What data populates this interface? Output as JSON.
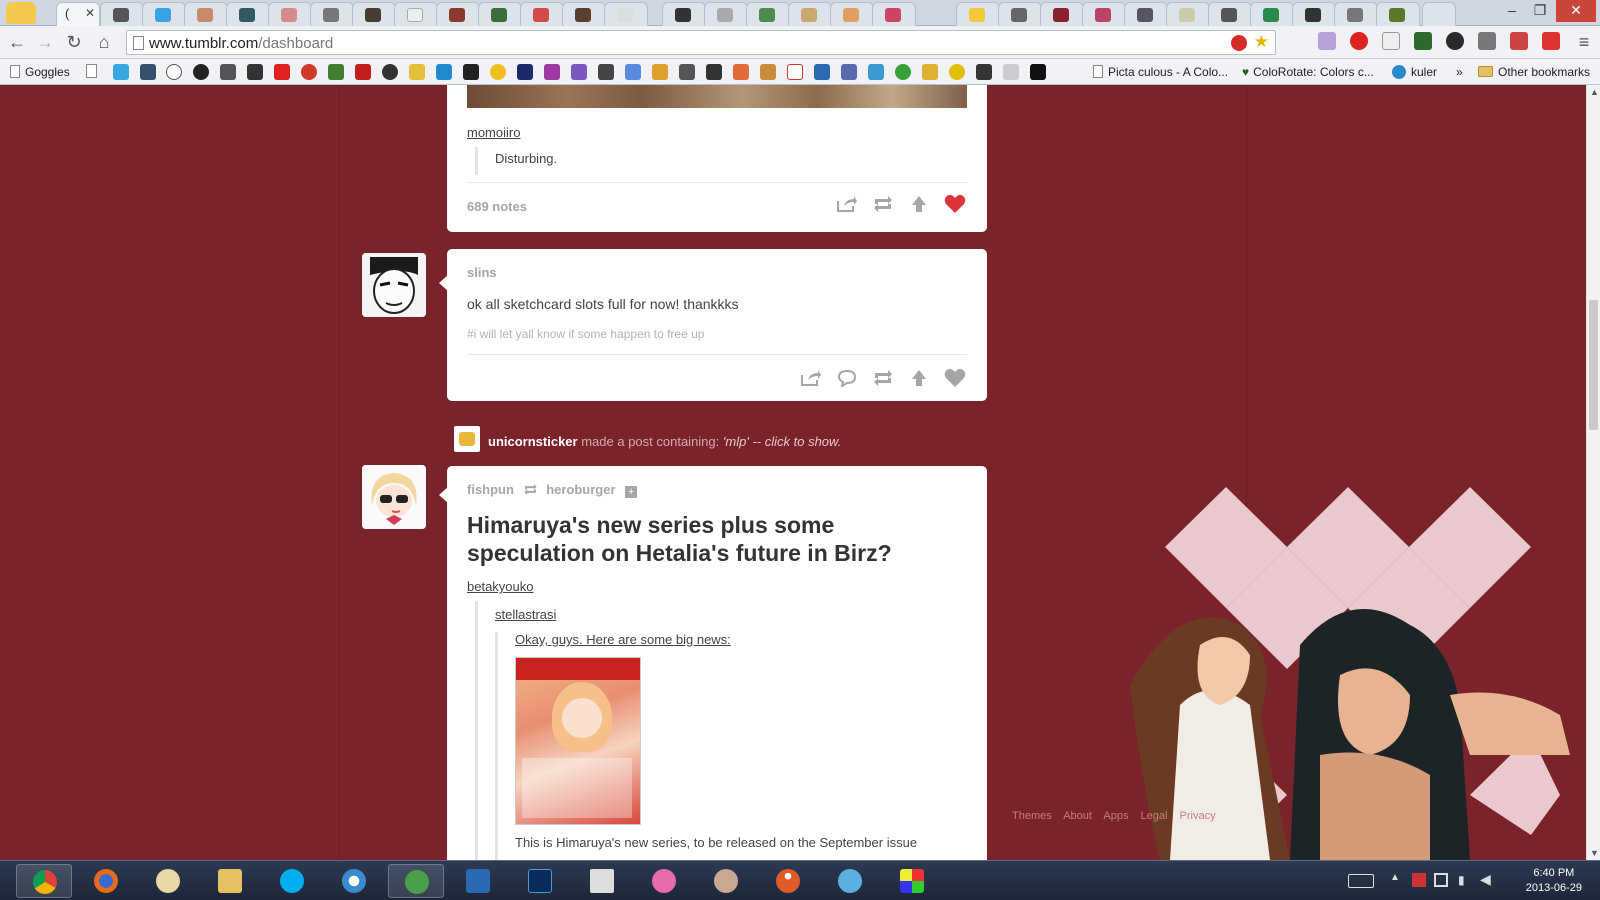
{
  "browser": {
    "url_host": "www.tumblr.com",
    "url_path": "/dashboard",
    "active_tab_title": "(",
    "bookmarks": [
      {
        "label": "Goggles",
        "type": "folder"
      },
      {
        "label": "Picta culous - A Colo...",
        "type": "page"
      },
      {
        "label": "ColoRotate: Colors c...",
        "type": "page"
      },
      {
        "label": "kuler",
        "type": "page"
      },
      {
        "label": "»",
        "type": "more"
      },
      {
        "label": "Other bookmarks",
        "type": "folder"
      }
    ]
  },
  "posts": [
    {
      "source": "momoiiro",
      "quote": "Disturbing.",
      "notes": "689 notes",
      "liked": true
    },
    {
      "username": "slins",
      "body": "ok all sketchcard slots full for now! thankkks",
      "tags": "#i will let yall know if some happen to free up",
      "liked": false
    }
  ],
  "activity": {
    "user": "unicornsticker",
    "text": "made a post containing:",
    "query": "'mlp'",
    "separator": "--",
    "action": "click to show."
  },
  "post3": {
    "reblogger": "fishpun",
    "reblogged_from": "heroburger",
    "title": "Himaruya's new series plus some speculation on Hetalia's future in Birz?",
    "chain": [
      {
        "user": "betakyouko"
      },
      {
        "user": "stellastrasi"
      }
    ],
    "announcement": "Okay, guys. Here are some big news:",
    "caption": "This is Himaruya's new series, to be released on the September issue"
  },
  "footer": [
    "Themes",
    "About",
    "Apps",
    "Legal",
    "Privacy"
  ],
  "taskbar": {
    "time": "6:40 PM",
    "date": "2013-06-29"
  },
  "colors": {
    "background": "#7a232b",
    "like_red": "#d9343a",
    "card": "#ffffff"
  }
}
